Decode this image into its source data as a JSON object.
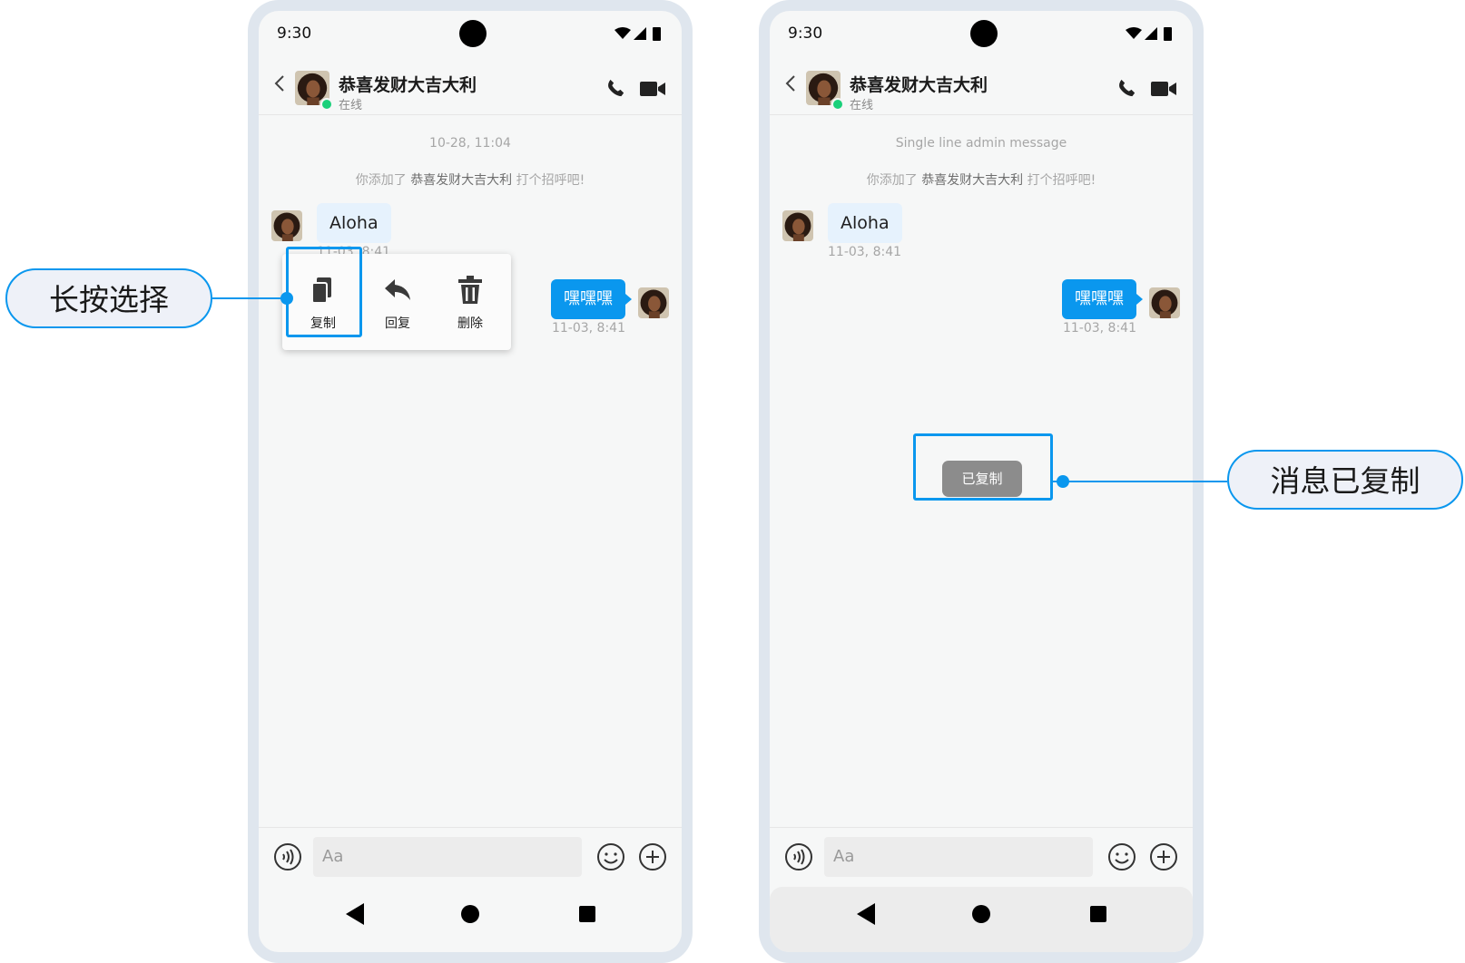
{
  "colors": {
    "accent": "#0a97ee",
    "online": "#1ad07a",
    "bubble_in": "#e6f2fd",
    "toast": "#8c8c8c"
  },
  "left_phone": {
    "status_time": "9:30",
    "contact_name": "恭喜发财大吉大利",
    "contact_status": "在线",
    "system_time": "10-28, 11:04",
    "system_tip": {
      "prefix": "你添加了",
      "name": "恭喜发财大吉大利",
      "suffix": "打个招呼吧!"
    },
    "incoming": {
      "text": "Aloha",
      "time": "11-03, 8:41"
    },
    "outgoing": {
      "text": "嘿嘿嘿",
      "time": "11-03, 8:41"
    },
    "context_menu": [
      {
        "label": "复制",
        "icon": "copy-icon"
      },
      {
        "label": "回复",
        "icon": "reply-icon"
      },
      {
        "label": "删除",
        "icon": "trash-icon"
      }
    ],
    "input_placeholder": "Aa"
  },
  "right_phone": {
    "status_time": "9:30",
    "contact_name": "恭喜发财大吉大利",
    "contact_status": "在线",
    "system_time": "Single line admin message",
    "system_tip": {
      "prefix": "你添加了",
      "name": "恭喜发财大吉大利",
      "suffix": "打个招呼吧!"
    },
    "incoming": {
      "text": "Aloha",
      "time": "11-03, 8:41"
    },
    "outgoing": {
      "text": "嘿嘿嘿",
      "time": "11-03, 8:41"
    },
    "toast": "已复制",
    "input_placeholder": "Aa"
  },
  "callouts": {
    "long_press": "长按选择",
    "copied": "消息已复制"
  }
}
